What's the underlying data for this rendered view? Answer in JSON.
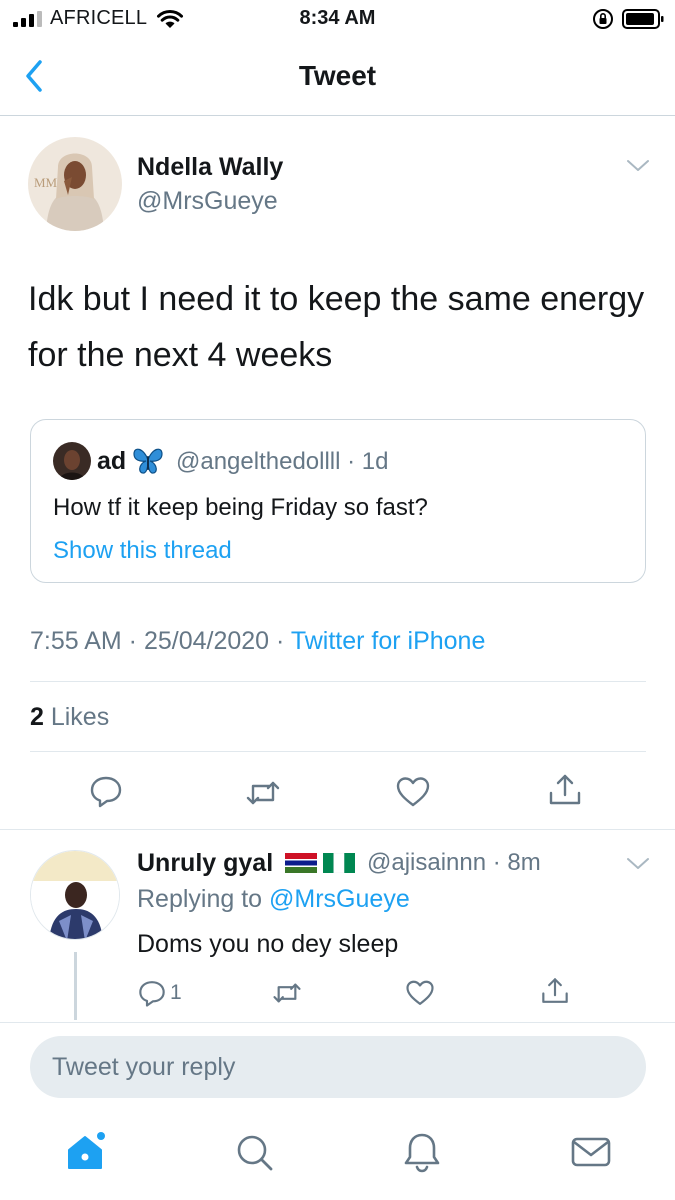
{
  "status_bar": {
    "carrier": "AFRICELL",
    "time": "8:34 AM",
    "icons": [
      "signal-icon",
      "wifi-icon",
      "orientation-lock-icon",
      "battery-icon"
    ]
  },
  "nav": {
    "title": "Tweet",
    "back_icon": "chevron-left-icon"
  },
  "tweet": {
    "author_name": "Ndella Wally",
    "author_handle": "@MrsGueye",
    "text": "Idk but I need it to keep the same energy for the next 4 weeks",
    "quote": {
      "author_name": "ad",
      "author_handle": "@angelthedollll · 1d",
      "text": "How tf it keep being Friday so fast?",
      "link": "Show this thread"
    },
    "meta_time": "7:55 AM · 25/04/2020 · ",
    "meta_source": "Twitter for iPhone",
    "likes_count": "2",
    "likes_label": " Likes",
    "actions": [
      "reply-icon",
      "retweet-icon",
      "like-icon",
      "share-icon"
    ]
  },
  "reply": {
    "author_name": "Unruly gyal",
    "author_handle": "@ajisainnn · 8m",
    "replying_to_label": "Replying to ",
    "replying_to_handle": "@MrsGueye",
    "text": "Doms you no dey sleep",
    "reply_count": "1"
  },
  "composer": {
    "placeholder": "Tweet your reply"
  },
  "tab_bar": [
    "home-icon",
    "search-icon",
    "notifications-icon",
    "messages-icon"
  ],
  "colors": {
    "accent": "#1da1f2",
    "secondary_text": "#657786",
    "divider": "#e1e8ed",
    "composer_bg": "#e6ecf0"
  }
}
